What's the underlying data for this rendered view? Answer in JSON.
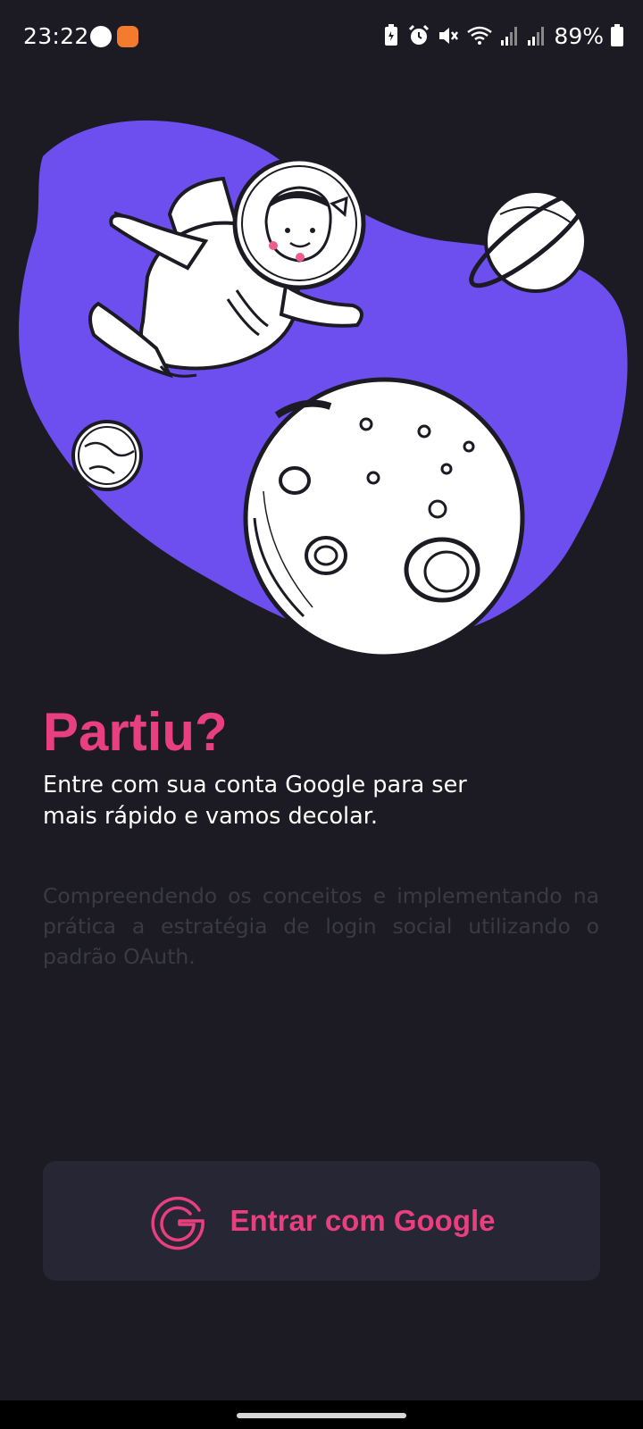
{
  "status_bar": {
    "time": "23:22",
    "battery": "89%",
    "icons": [
      "app-notification-icon",
      "mi-app-icon",
      "battery-saver-icon",
      "alarm-icon",
      "mute-icon",
      "wifi-icon",
      "signal-icon",
      "signal-icon-2",
      "battery-icon"
    ]
  },
  "hero": {
    "illustration": "astronaut-floating-in-space",
    "blob_color": "#6d4ff0"
  },
  "content": {
    "headline": "Partiu?",
    "subtitle": "Entre com sua conta Google para ser mais rápido e vamos decolar.",
    "description": "Compreendendo os conceitos e implementando na prática a estratégia de login social utilizando o padrão OAuth."
  },
  "login_button": {
    "label": "Entrar com Google",
    "icon": "google-icon"
  },
  "colors": {
    "background": "#1c1b24",
    "accent": "#e83f7f",
    "button_background": "#272635",
    "description_text": "#3a3a45"
  }
}
